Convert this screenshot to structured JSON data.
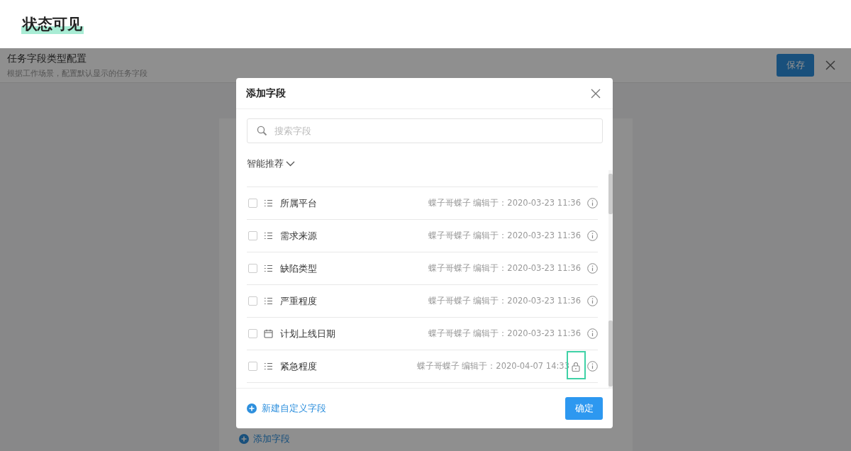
{
  "page_title": "状态可见",
  "background": {
    "title": "任务字段类型配置",
    "subtitle": "根据工作场景，配置默认显示的任务字段",
    "save_button": "保存",
    "add_link": "添加字段"
  },
  "dialog": {
    "title": "添加字段",
    "search": {
      "placeholder": "搜索字段"
    },
    "section": "智能推荐",
    "fields": [
      {
        "name": "所属平台",
        "kind": "select",
        "checked": false,
        "meta": "蝶子哥蝶子 编辑于：2020-03-23 11:36",
        "locked": false,
        "highlighted": false
      },
      {
        "name": "需求来源",
        "kind": "select",
        "checked": false,
        "meta": "蝶子哥蝶子 编辑于：2020-03-23 11:36",
        "locked": false,
        "highlighted": false
      },
      {
        "name": "缺陷类型",
        "kind": "select",
        "checked": false,
        "meta": "蝶子哥蝶子 编辑于：2020-03-23 11:36",
        "locked": false,
        "highlighted": false
      },
      {
        "name": "严重程度",
        "kind": "select",
        "checked": false,
        "meta": "蝶子哥蝶子 编辑于：2020-03-23 11:36",
        "locked": false,
        "highlighted": false
      },
      {
        "name": "计划上线日期",
        "kind": "date",
        "checked": false,
        "meta": "蝶子哥蝶子 编辑于：2020-03-23 11:36",
        "locked": false,
        "highlighted": false
      },
      {
        "name": "紧急程度",
        "kind": "select",
        "checked": false,
        "meta": "蝶子哥蝶子 编辑于：2020-04-07 14:33",
        "locked": true,
        "highlighted": true
      }
    ],
    "new_field_link": "新建自定义字段",
    "confirm_button": "确定"
  }
}
